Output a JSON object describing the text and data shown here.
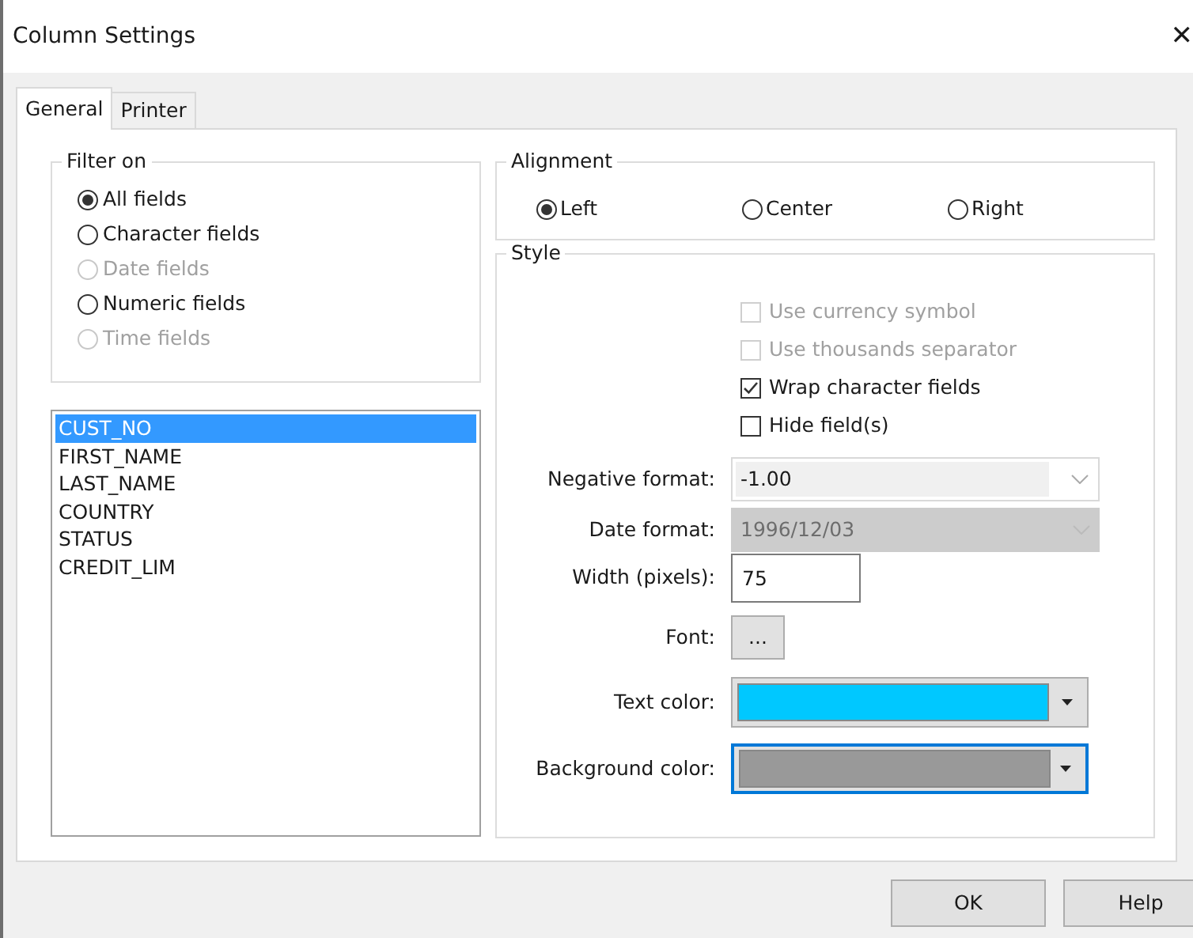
{
  "window": {
    "title": "Column Settings",
    "close": "✕"
  },
  "tabs": [
    {
      "label": "General",
      "selected": true
    },
    {
      "label": "Printer",
      "selected": false
    }
  ],
  "filter": {
    "title": "Filter on",
    "options": [
      {
        "label": "All fields",
        "selected": true,
        "disabled": false
      },
      {
        "label": "Character fields",
        "selected": false,
        "disabled": false
      },
      {
        "label": "Date fields",
        "selected": false,
        "disabled": true
      },
      {
        "label": "Numeric fields",
        "selected": false,
        "disabled": false
      },
      {
        "label": "Time fields",
        "selected": false,
        "disabled": true
      }
    ]
  },
  "fields": [
    {
      "label": "CUST_NO",
      "selected": true
    },
    {
      "label": "FIRST_NAME",
      "selected": false
    },
    {
      "label": "LAST_NAME",
      "selected": false
    },
    {
      "label": "COUNTRY",
      "selected": false
    },
    {
      "label": "STATUS",
      "selected": false
    },
    {
      "label": "CREDIT_LIM",
      "selected": false
    }
  ],
  "alignment": {
    "title": "Alignment",
    "options": [
      {
        "label": "Left",
        "selected": true
      },
      {
        "label": "Center",
        "selected": false
      },
      {
        "label": "Right",
        "selected": false
      }
    ]
  },
  "style": {
    "title": "Style",
    "checkboxes": [
      {
        "label": "Use currency symbol",
        "checked": false,
        "disabled": true
      },
      {
        "label": "Use thousands separator",
        "checked": false,
        "disabled": true
      },
      {
        "label": "Wrap character fields",
        "checked": true,
        "disabled": false
      },
      {
        "label": "Hide field(s)",
        "checked": false,
        "disabled": false
      }
    ],
    "rows": [
      {
        "kind": "combo",
        "label": "Negative format:",
        "value": "-1.00",
        "disabled": false
      },
      {
        "kind": "combo",
        "label": "Date format:",
        "value": "1996/12/03",
        "disabled": true
      },
      {
        "kind": "text",
        "label": "Width (pixels):",
        "value": "75"
      },
      {
        "kind": "button",
        "label": "Font:",
        "value": "..."
      },
      {
        "kind": "color",
        "label": "Text color:",
        "color": "#00c8ff",
        "focused": false
      },
      {
        "kind": "color",
        "label": "Background color:",
        "color": "#999999",
        "focused": true
      }
    ]
  },
  "buttons": [
    "OK",
    "Help"
  ]
}
